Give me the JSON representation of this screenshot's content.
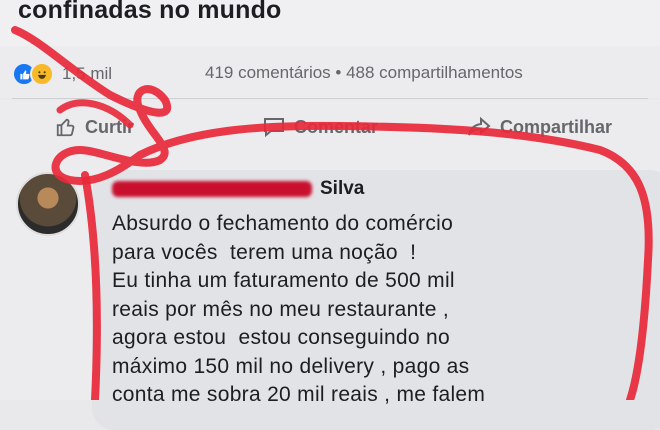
{
  "post": {
    "title": "confinadas no mundo",
    "reactions_count": "1,5 mil",
    "stats_right": "419 comentários • 488 compartilhamentos"
  },
  "actions": {
    "like_label": "Curtir",
    "comment_label": "Comentar",
    "share_label": "Compartilhar"
  },
  "comment": {
    "author_visible": "Silva",
    "lines": [
      "Absurdo o fechamento do comércio",
      "para vocês  terem uma noção  !",
      "Eu tinha um faturamento de 500 mil",
      "reais por mês no meu restaurante ,",
      "agora estou  estou conseguindo no",
      "máximo 150 mil no delivery , pago as",
      "conta me sobra 20 mil reais , me falem"
    ]
  },
  "icons": {
    "like_reaction": "thumbs-up-icon",
    "haha_reaction": "haha-emoji-icon",
    "comment": "speech-bubble-icon",
    "share": "share-arrow-icon"
  },
  "colors": {
    "background": "#ececef",
    "bubble": "#e2e3e7",
    "like_blue": "#1877f2",
    "scribble_red": "#e8293a"
  }
}
